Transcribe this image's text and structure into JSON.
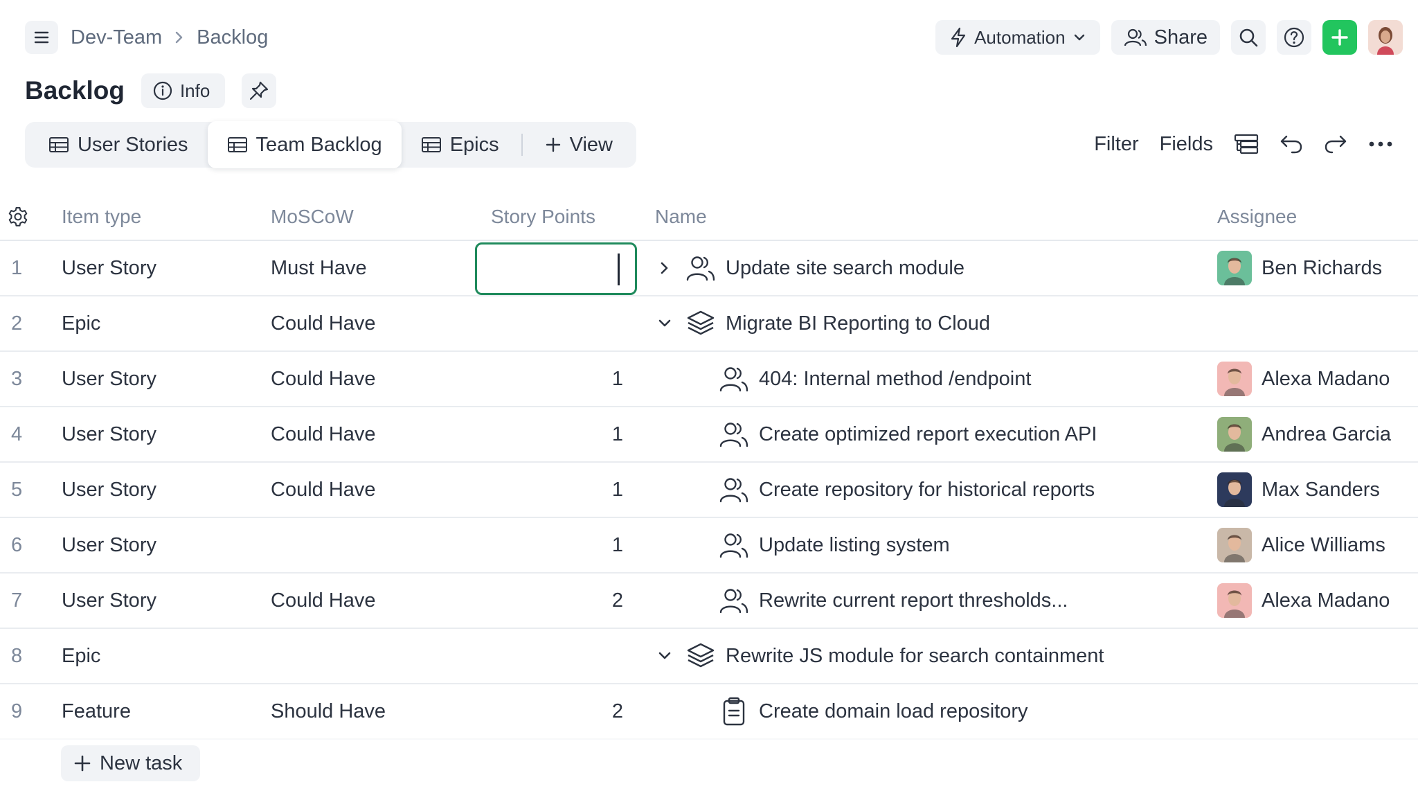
{
  "header": {
    "breadcrumb": [
      "Dev-Team",
      "Backlog"
    ],
    "automation_label": "Automation",
    "share_label": "Share",
    "accent_green": "#22c55e"
  },
  "page": {
    "title": "Backlog",
    "info_label": "Info"
  },
  "views": {
    "tabs": [
      {
        "label": "User Stories",
        "active": false
      },
      {
        "label": "Team Backlog",
        "active": true
      },
      {
        "label": "Epics",
        "active": false
      }
    ],
    "add_view_label": "View",
    "filter_label": "Filter",
    "fields_label": "Fields"
  },
  "table": {
    "columns": {
      "item_type": "Item type",
      "moscow": "MoSCoW",
      "story_points": "Story Points",
      "name": "Name",
      "assignee": "Assignee"
    },
    "rows": [
      {
        "num": "1",
        "type": "User Story",
        "moscow": "Must Have",
        "points": "",
        "name": "Update site search module",
        "icon": "user-story-icon",
        "chevron": "right",
        "assignee": "Ben Richards",
        "avatar_color": "#6bbf9a"
      },
      {
        "num": "2",
        "type": "Epic",
        "moscow": "Could Have",
        "points": "",
        "name": "Migrate BI Reporting to Cloud",
        "icon": "epic-stack-icon",
        "chevron": "down",
        "assignee": "",
        "avatar_color": ""
      },
      {
        "num": "3",
        "type": "User Story",
        "moscow": "Could Have",
        "points": "1",
        "name": "404: Internal method /endpoint",
        "icon": "user-story-icon",
        "chevron": "",
        "assignee": "Alexa Madano",
        "avatar_color": "#f2b8b5"
      },
      {
        "num": "4",
        "type": "User Story",
        "moscow": "Could Have",
        "points": "1",
        "name": "Create optimized report execution API",
        "icon": "user-story-icon",
        "chevron": "",
        "assignee": "Andrea Garcia",
        "avatar_color": "#8fae7a"
      },
      {
        "num": "5",
        "type": "User Story",
        "moscow": "Could Have",
        "points": "1",
        "name": "Create repository for historical reports",
        "icon": "user-story-icon",
        "chevron": "",
        "assignee": "Max Sanders",
        "avatar_color": "#2d3a5c"
      },
      {
        "num": "6",
        "type": "User Story",
        "moscow": "",
        "points": "1",
        "name": "Update listing system",
        "icon": "user-story-icon",
        "chevron": "",
        "assignee": "Alice Williams",
        "avatar_color": "#c9b8a8"
      },
      {
        "num": "7",
        "type": "User Story",
        "moscow": "Could Have",
        "points": "2",
        "name": "Rewrite current report thresholds...",
        "icon": "user-story-icon",
        "chevron": "",
        "assignee": "Alexa Madano",
        "avatar_color": "#f2b8b5"
      },
      {
        "num": "8",
        "type": "Epic",
        "moscow": "",
        "points": "",
        "name": "Rewrite JS module for search containment",
        "icon": "epic-stack-icon",
        "chevron": "down",
        "assignee": "",
        "avatar_color": ""
      },
      {
        "num": "9",
        "type": "Feature",
        "moscow": "Should Have",
        "points": "2",
        "name": "Create domain load repository",
        "icon": "feature-clipboard-icon",
        "chevron": "",
        "assignee": "",
        "avatar_color": ""
      }
    ]
  },
  "footer": {
    "new_task_label": "New task"
  }
}
